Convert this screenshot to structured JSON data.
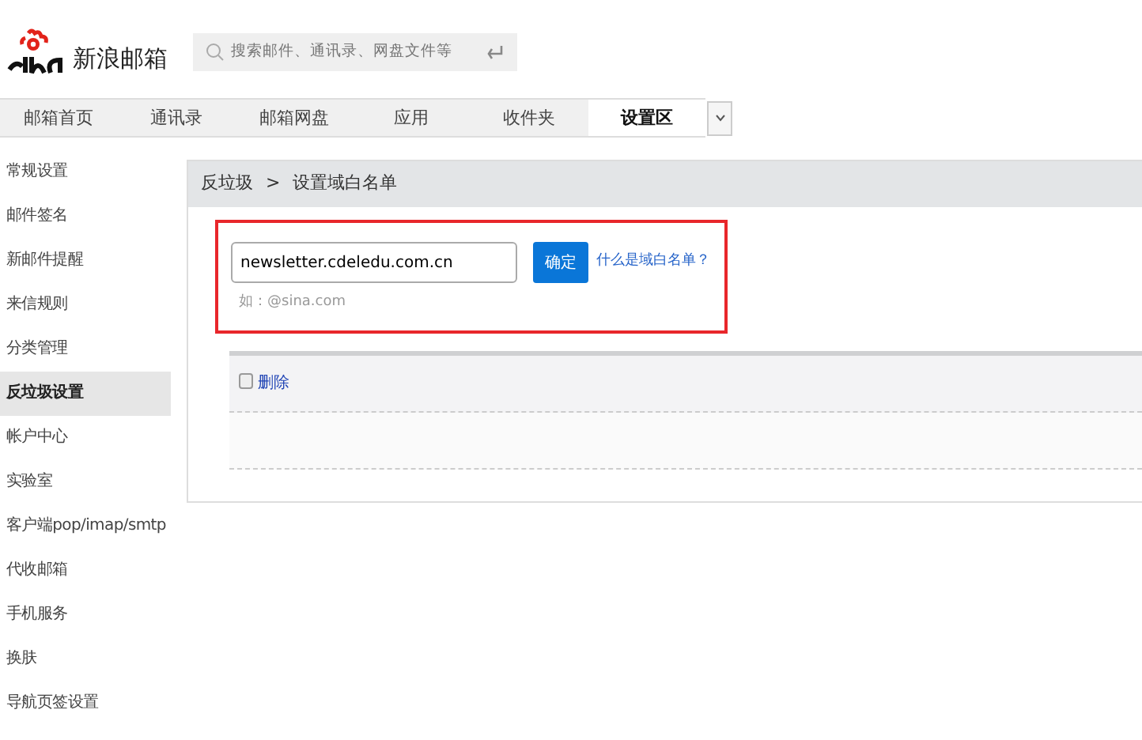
{
  "logo": {
    "text": "新浪邮箱"
  },
  "search": {
    "placeholder": "搜索邮件、通讯录、网盘文件等"
  },
  "tabs": [
    {
      "label": "邮箱首页",
      "selected": false
    },
    {
      "label": "通讯录",
      "selected": false
    },
    {
      "label": "邮箱网盘",
      "selected": false
    },
    {
      "label": "应用",
      "selected": false
    },
    {
      "label": "收件夹",
      "selected": false
    },
    {
      "label": "设置区",
      "selected": true
    }
  ],
  "sidebar": {
    "items": [
      {
        "label": "常规设置",
        "selected": false
      },
      {
        "label": "邮件签名",
        "selected": false
      },
      {
        "label": "新邮件提醒",
        "selected": false
      },
      {
        "label": "来信规则",
        "selected": false
      },
      {
        "label": "分类管理",
        "selected": false
      },
      {
        "label": "反垃圾设置",
        "selected": true
      },
      {
        "label": "帐户中心",
        "selected": false
      },
      {
        "label": "实验室",
        "selected": false
      },
      {
        "label": "客户端pop/imap/smtp",
        "selected": false
      },
      {
        "label": "代收邮箱",
        "selected": false
      },
      {
        "label": "手机服务",
        "selected": false
      },
      {
        "label": "换肤",
        "selected": false
      },
      {
        "label": "导航页签设置",
        "selected": false
      }
    ]
  },
  "breadcrumb": [
    "反垃圾",
    "设置域白名单"
  ],
  "breadcrumb_separator": ">",
  "domain_form": {
    "value": "newsletter.cdeledu.com.cn",
    "button": "确定",
    "help_link": "什么是域白名单？",
    "hint": "如：@sina.com"
  },
  "list": {
    "select_all_checked": false,
    "delete_link": "删除"
  }
}
